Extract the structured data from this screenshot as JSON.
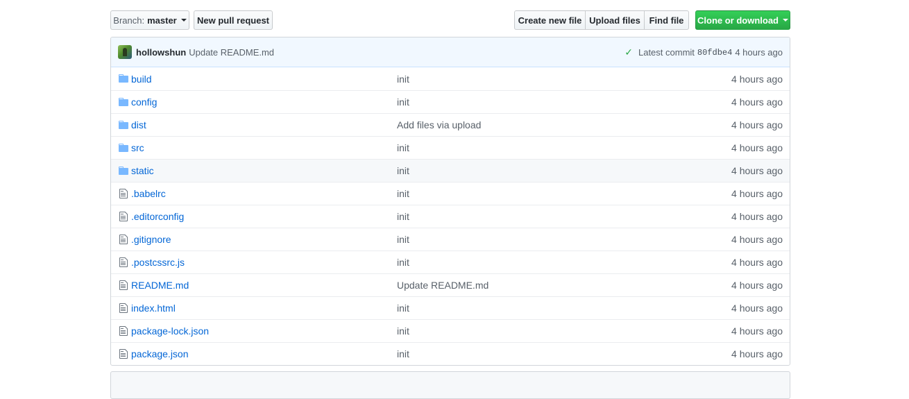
{
  "toolbar": {
    "branch_prefix": "Branch:",
    "branch_name": "master",
    "new_pull_request": "New pull request",
    "create_new_file": "Create new file",
    "upload_files": "Upload files",
    "find_file": "Find file",
    "clone_or_download": "Clone or download"
  },
  "commit": {
    "author": "hollowshun",
    "message": "Update README.md",
    "latest_label": "Latest commit",
    "sha": "80fdbe4",
    "age": "4 hours ago"
  },
  "files": [
    {
      "type": "folder",
      "icon": "folder-icon",
      "name": "build",
      "message": "init",
      "age": "4 hours ago"
    },
    {
      "type": "folder",
      "icon": "folder-icon",
      "name": "config",
      "message": "init",
      "age": "4 hours ago"
    },
    {
      "type": "folder",
      "icon": "folder-icon",
      "name": "dist",
      "message": "Add files via upload",
      "age": "4 hours ago"
    },
    {
      "type": "folder",
      "icon": "folder-icon",
      "name": "src",
      "message": "init",
      "age": "4 hours ago"
    },
    {
      "type": "folder",
      "icon": "folder-icon",
      "name": "static",
      "message": "init",
      "age": "4 hours ago",
      "hover": true
    },
    {
      "type": "file",
      "icon": "file-icon",
      "name": ".babelrc",
      "message": "init",
      "age": "4 hours ago"
    },
    {
      "type": "file",
      "icon": "file-icon",
      "name": ".editorconfig",
      "message": "init",
      "age": "4 hours ago"
    },
    {
      "type": "file",
      "icon": "file-icon",
      "name": ".gitignore",
      "message": "init",
      "age": "4 hours ago"
    },
    {
      "type": "file",
      "icon": "file-icon",
      "name": ".postcssrc.js",
      "message": "init",
      "age": "4 hours ago"
    },
    {
      "type": "file",
      "icon": "file-icon",
      "name": "README.md",
      "message": "Update README.md",
      "age": "4 hours ago"
    },
    {
      "type": "file",
      "icon": "file-icon",
      "name": "index.html",
      "message": "init",
      "age": "4 hours ago"
    },
    {
      "type": "file",
      "icon": "file-icon",
      "name": "package-lock.json",
      "message": "init",
      "age": "4 hours ago"
    },
    {
      "type": "file",
      "icon": "file-icon",
      "name": "package.json",
      "message": "init",
      "age": "4 hours ago"
    }
  ],
  "colors": {
    "link": "#0366d6",
    "folder_icon": "#79b8ff",
    "clone_button": "#28a745",
    "commit_bar": "#f1f8ff"
  }
}
